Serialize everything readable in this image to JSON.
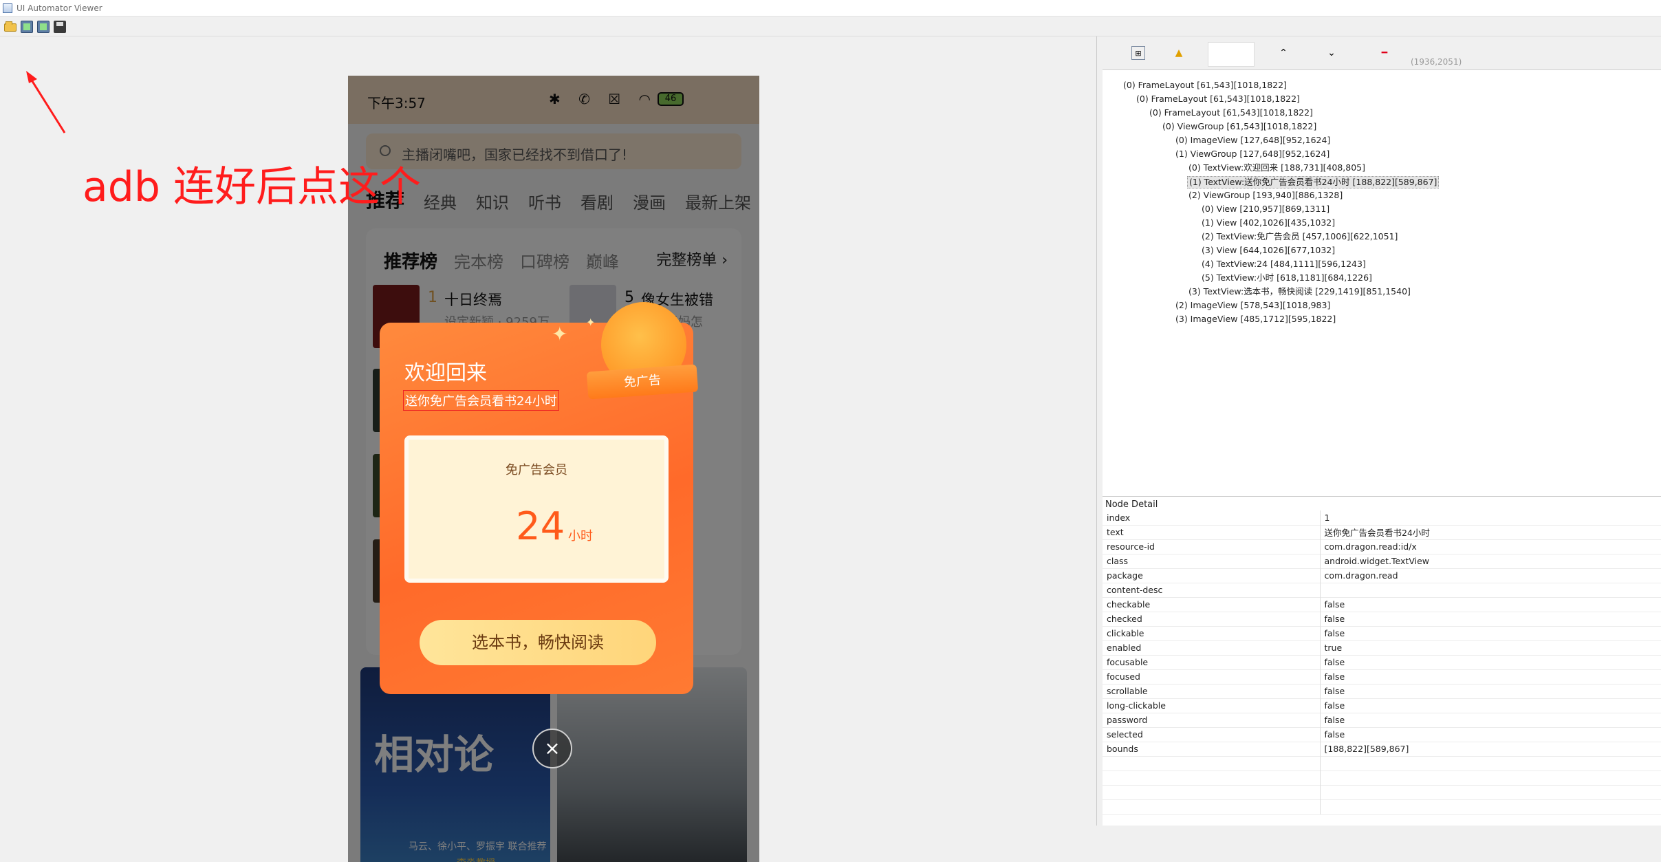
{
  "window": {
    "title": "UI Automator Viewer"
  },
  "annotation": {
    "text": "adb 连好后点这个"
  },
  "phone": {
    "status_time": "下午3:57",
    "battery": "46",
    "search_placeholder": "主播闭嘴吧，国家已经找不到借口了!",
    "nav_tabs": [
      "推荐",
      "经典",
      "知识",
      "听书",
      "看剧",
      "漫画",
      "最新上架"
    ],
    "rank_tabs": [
      "推荐榜",
      "完本榜",
      "口碑榜",
      "巅峰"
    ],
    "rank_more": "完整榜单 ›",
    "rank_items": [
      {
        "num": "1",
        "name": "十日终焉",
        "sub": "设定新颖 · 9259万…"
      },
      {
        "num": "5",
        "name": "像女生被错",
        "sub": "已经当妈怎"
      }
    ],
    "cover_a_title": "相对论",
    "cover_a_bottom": "马云、徐小平、罗振宇 联合推荐",
    "cover_a_author": "李淼教授",
    "dialog": {
      "title": "欢迎回来",
      "subtitle": "送你免广告会员看书24小时",
      "badge": "免广告",
      "ticket_label": "免广告会员",
      "ticket_num": "24",
      "ticket_unit": "小时",
      "button": "选本书，畅快阅读"
    },
    "close_glyph": "×"
  },
  "coords": "(1936,2051)",
  "tree": [
    {
      "text": "(0) FrameLayout [61,543][1018,1822]",
      "depth": 0
    },
    {
      "text": "(0) FrameLayout [61,543][1018,1822]",
      "depth": 1
    },
    {
      "text": "(0) FrameLayout [61,543][1018,1822]",
      "depth": 2
    },
    {
      "text": "(0) ViewGroup [61,543][1018,1822]",
      "depth": 3
    },
    {
      "text": "(0) ImageView [127,648][952,1624]",
      "depth": 4
    },
    {
      "text": "(1) ViewGroup [127,648][952,1624]",
      "depth": 4
    },
    {
      "text": "(0) TextView:欢迎回来 [188,731][408,805]",
      "depth": 5
    },
    {
      "text": "(1) TextView:送你免广告会员看书24小时 [188,822][589,867]",
      "depth": 5,
      "selected": true
    },
    {
      "text": "(2) ViewGroup [193,940][886,1328]",
      "depth": 5
    },
    {
      "text": "(0) View [210,957][869,1311]",
      "depth": 6
    },
    {
      "text": "(1) View [402,1026][435,1032]",
      "depth": 6
    },
    {
      "text": "(2) TextView:免广告会员 [457,1006][622,1051]",
      "depth": 6
    },
    {
      "text": "(3) View [644,1026][677,1032]",
      "depth": 6
    },
    {
      "text": "(4) TextView:24 [484,1111][596,1243]",
      "depth": 6
    },
    {
      "text": "(5) TextView:小时 [618,1181][684,1226]",
      "depth": 6
    },
    {
      "text": "(3) TextView:选本书，畅快阅读 [229,1419][851,1540]",
      "depth": 5
    },
    {
      "text": "(2) ImageView [578,543][1018,983]",
      "depth": 4
    },
    {
      "text": "(3) ImageView [485,1712][595,1822]",
      "depth": 4
    }
  ],
  "detail": {
    "header": "Node Detail",
    "rows": [
      [
        "index",
        "1"
      ],
      [
        "text",
        "送你免广告会员看书24小时"
      ],
      [
        "resource-id",
        "com.dragon.read:id/x"
      ],
      [
        "class",
        "android.widget.TextView"
      ],
      [
        "package",
        "com.dragon.read"
      ],
      [
        "content-desc",
        ""
      ],
      [
        "checkable",
        "false"
      ],
      [
        "checked",
        "false"
      ],
      [
        "clickable",
        "false"
      ],
      [
        "enabled",
        "true"
      ],
      [
        "focusable",
        "false"
      ],
      [
        "focused",
        "false"
      ],
      [
        "scrollable",
        "false"
      ],
      [
        "long-clickable",
        "false"
      ],
      [
        "password",
        "false"
      ],
      [
        "selected",
        "false"
      ],
      [
        "bounds",
        "[188,822][589,867]"
      ]
    ]
  }
}
